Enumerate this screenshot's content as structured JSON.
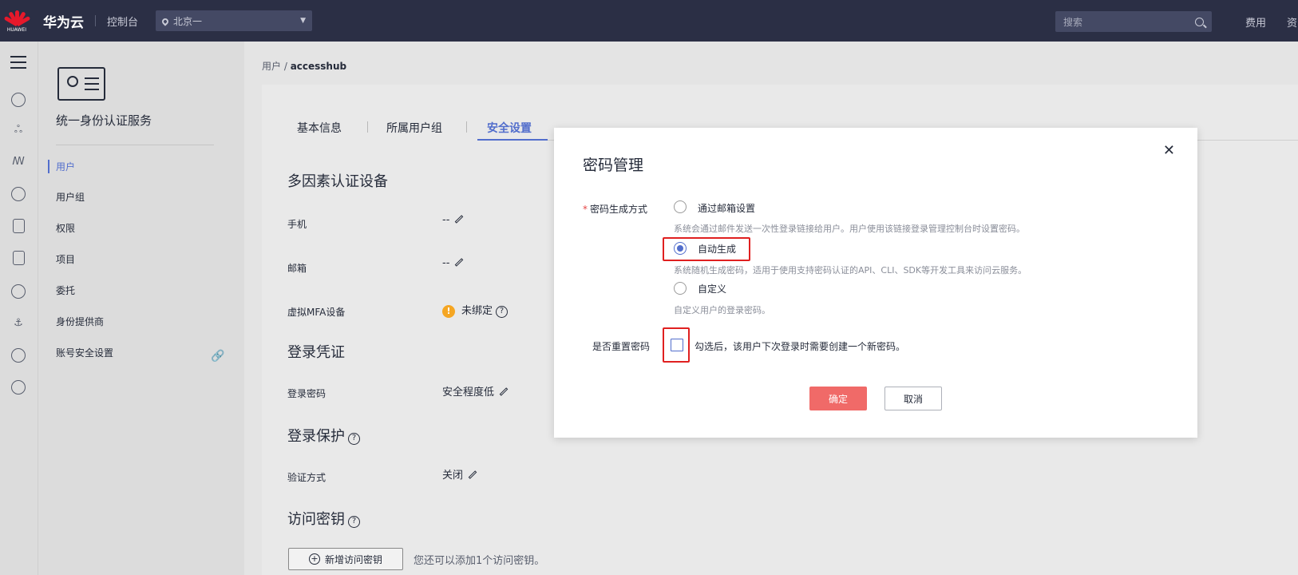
{
  "topbar": {
    "logo_text": "HUAWEI",
    "brand": "华为云",
    "console": "控制台",
    "region": "北京一",
    "search_placeholder": "搜索",
    "fee": "费用",
    "more": "资"
  },
  "sidebar": {
    "service_title": "统一身份认证服务",
    "items": [
      {
        "label": "用户",
        "active": true
      },
      {
        "label": "用户组"
      },
      {
        "label": "权限"
      },
      {
        "label": "项目"
      },
      {
        "label": "委托"
      },
      {
        "label": "身份提供商"
      },
      {
        "label": "账号安全设置"
      }
    ]
  },
  "breadcrumb": {
    "parent": "用户 / ",
    "current": "accesshub"
  },
  "tabs": [
    {
      "label": "基本信息"
    },
    {
      "label": "所属用户组"
    },
    {
      "label": "安全设置",
      "active": true
    }
  ],
  "sections": {
    "mfa_heading": "多因素认证设备",
    "phone_label": "手机",
    "phone_value": "--",
    "email_label": "邮箱",
    "email_value": "--",
    "vmfa_label": "虚拟MFA设备",
    "vmfa_value": "未绑定",
    "cred_heading": "登录凭证",
    "pwd_label": "登录密码",
    "pwd_value": "安全程度低",
    "protect_heading": "登录保护",
    "verify_label": "验证方式",
    "verify_value": "关闭",
    "ak_heading": "访问密钥",
    "ak_button": "新增访问密钥",
    "ak_note": "您还可以添加1个访问密钥。"
  },
  "modal": {
    "title": "密码管理",
    "gen_label": "密码生成方式",
    "options": [
      {
        "label": "通过邮箱设置",
        "hint": "系统会通过邮件发送一次性登录链接给用户。用户使用该链接登录管理控制台时设置密码。",
        "selected": false
      },
      {
        "label": "自动生成",
        "hint": "系统随机生成密码，适用于使用支持密码认证的API、CLI、SDK等开发工具来访问云服务。",
        "selected": true
      },
      {
        "label": "自定义",
        "hint": "自定义用户的登录密码。",
        "selected": false
      }
    ],
    "reset_label": "是否重置密码",
    "reset_hint": "勾选后，该用户下次登录时需要创建一个新密码。",
    "reset_checked": false,
    "ok": "确定",
    "cancel": "取消"
  },
  "colors": {
    "accent": "#526ecc",
    "danger": "#e02020",
    "primary_btn": "#f06a68",
    "topbar": "#2b2f45"
  }
}
